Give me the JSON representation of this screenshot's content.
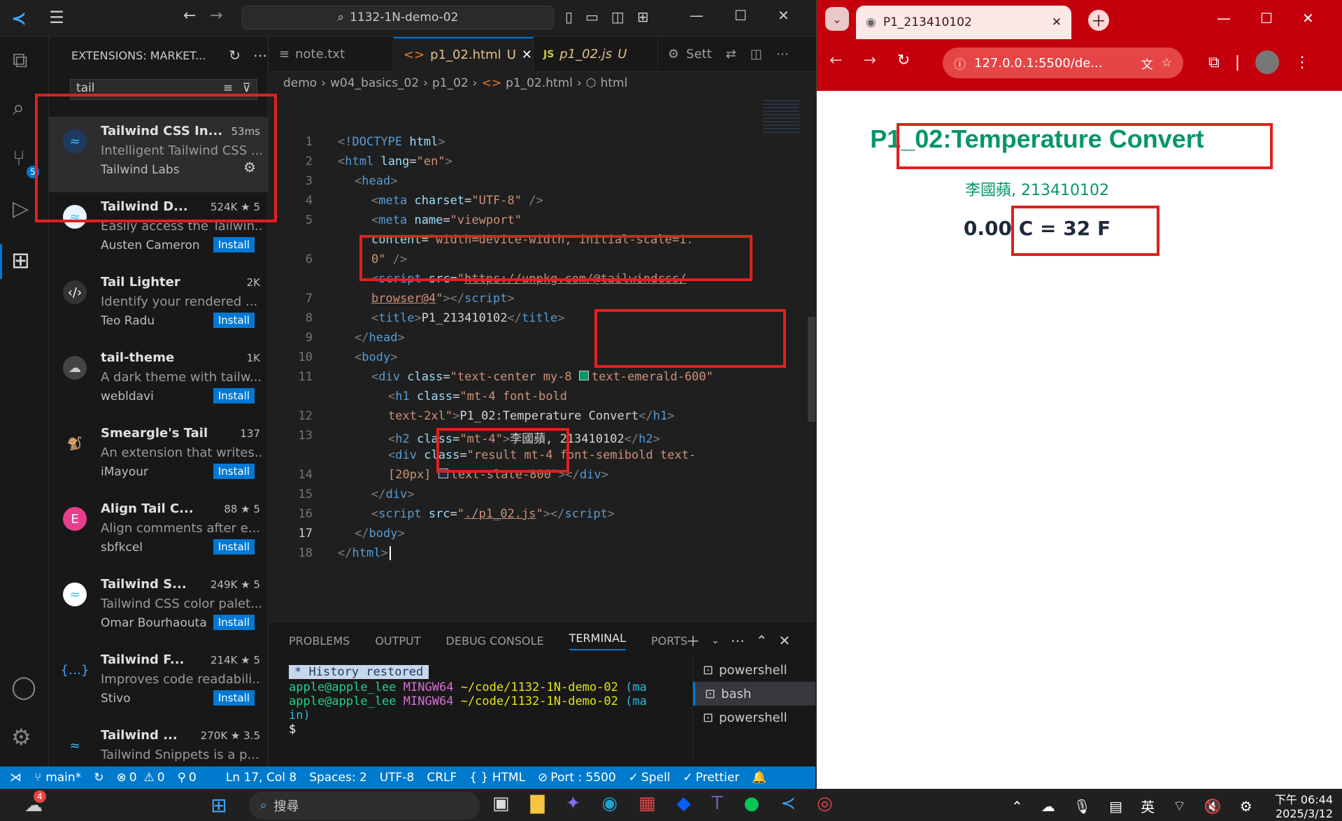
{
  "vscode": {
    "search_box": "1132-1N-demo-02",
    "sidebar_title": "EXTENSIONS: MARKET...",
    "search_query": "tail",
    "extensions": [
      {
        "name": "Tailwind CSS In...",
        "desc": "Intelligent Tailwind CSS ...",
        "publisher": "Tailwind Labs",
        "stats": "53ms",
        "install": ""
      },
      {
        "name": "Tailwind D...",
        "desc": "Easily access the Tailwin...",
        "publisher": "Austen Cameron",
        "stats": "524K ★ 5",
        "install": "Install"
      },
      {
        "name": "Tail Lighter",
        "desc": "Identify your rendered ...",
        "publisher": "Teo Radu",
        "stats": "2K",
        "install": "Install"
      },
      {
        "name": "tail-theme",
        "desc": "A dark theme with tailw...",
        "publisher": "webldavi",
        "stats": "1K",
        "install": "Install"
      },
      {
        "name": "Smeargle's Tail",
        "desc": "An extension that writes...",
        "publisher": "iMayour",
        "stats": "137",
        "install": "Install"
      },
      {
        "name": "Align Tail C...",
        "desc": "Align comments after e...",
        "publisher": "sbfkcel",
        "stats": "88 ★ 5",
        "install": "Install"
      },
      {
        "name": "Tailwind S...",
        "desc": "Tailwind CSS color palet...",
        "publisher": "Omar Bourhaouta",
        "stats": "249K ★ 5",
        "install": "Install"
      },
      {
        "name": "Tailwind F...",
        "desc": "Improves code readabili...",
        "publisher": "Stivo",
        "stats": "214K ★ 5",
        "install": "Install"
      },
      {
        "name": "Tailwind ...",
        "desc": "Tailwind Snippets is a p...",
        "publisher": "",
        "stats": "270K ★ 3.5",
        "install": ""
      }
    ],
    "tabs": [
      "note.txt",
      "p1_02.html",
      "p1_02.js",
      "Sett"
    ],
    "tab_badges": [
      "",
      "U",
      "U",
      ""
    ],
    "breadcrumb": [
      "demo",
      "w04_basics_02",
      "p1_02",
      "p1_02.html",
      "html"
    ],
    "panel_tabs": [
      "PROBLEMS",
      "OUTPUT",
      "DEBUG CONSOLE",
      "TERMINAL",
      "PORTS"
    ],
    "terminal": {
      "restored": "History restored",
      "line1_user": "apple@apple_lee",
      "line1_host": "MINGW64",
      "line1_path": "~/code/1132-1N-demo-02",
      "line1_branch": "(ma",
      "line2_user": "apple@apple_lee",
      "line2_host": "MINGW64",
      "line2_path": "~/code/1132-1N-demo-02",
      "line2_branch": "(ma",
      "line3": "in)",
      "prompt": "$"
    },
    "terminals": [
      "powershell",
      "bash",
      "powershell"
    ],
    "status": {
      "branch": "main*",
      "errors": "0",
      "warnings": "0",
      "ports": "0",
      "position": "Ln 17, Col 8",
      "spaces": "Spaces: 2",
      "encoding": "UTF-8",
      "eol": "CRLF",
      "lang": "{ } HTML",
      "port": "Port : 5500",
      "spell": "Spell",
      "prettier": "Prettier"
    },
    "activity_badge": "5"
  },
  "code_lines": [
    "1",
    "2",
    "3",
    "4",
    "5",
    "",
    "6",
    "",
    "7",
    "8",
    "9",
    "10",
    "11",
    "",
    "12",
    "13",
    "",
    "14",
    "15",
    "16",
    "17",
    "18"
  ],
  "browser": {
    "tab_title": "P1_213410102",
    "url": "127.0.0.1:5500/de...",
    "heading": "P1_02:Temperature Convert",
    "subheading": "李國蘋, 213410102",
    "result": "0.00 C = 32 F"
  },
  "taskbar": {
    "weather_badge": "4",
    "search": "搜尋",
    "time": "下午 06:44",
    "date": "2025/3/12",
    "ime": "英"
  },
  "colors": {
    "accent": "#007acc",
    "emerald": "#059669",
    "slate": "#1e293b",
    "annotation": "#e02020"
  }
}
